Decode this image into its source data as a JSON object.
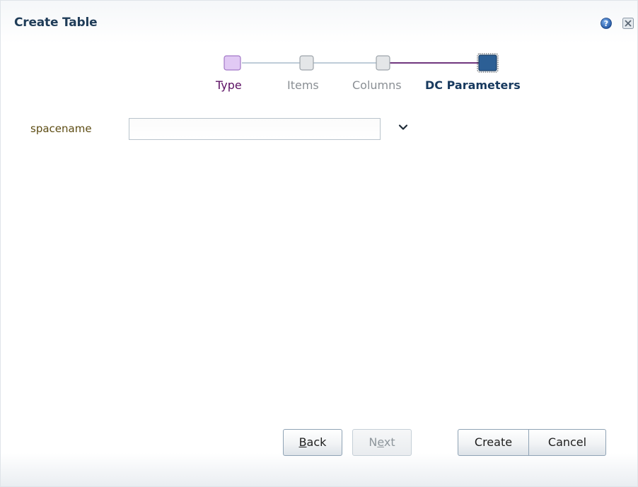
{
  "dialog": {
    "title": "Create Table"
  },
  "train": {
    "stops": [
      {
        "label": "Type",
        "state": "visited"
      },
      {
        "label": "Items",
        "state": "unvisited"
      },
      {
        "label": "Columns",
        "state": "unvisited"
      },
      {
        "label": "DC Parameters",
        "state": "current"
      }
    ]
  },
  "form": {
    "spacename_label": "spacename",
    "spacename_value": "",
    "spacename_placeholder": ""
  },
  "buttons": {
    "back_prefix": "",
    "back_mnemonic": "B",
    "back_rest": "ack",
    "next_prefix": "N",
    "next_mnemonic": "e",
    "next_rest": "xt",
    "create": "Create",
    "cancel": "Cancel"
  },
  "icons": {
    "help": "help-icon",
    "close": "close-icon",
    "dropdown": "chevron-down-icon"
  },
  "colors": {
    "title": "#1f3c58",
    "visited_stop": "#5b0f63",
    "current_stop": "#17395e",
    "unvisited_stop": "#8a8f94",
    "form_label": "#5d4c13"
  }
}
